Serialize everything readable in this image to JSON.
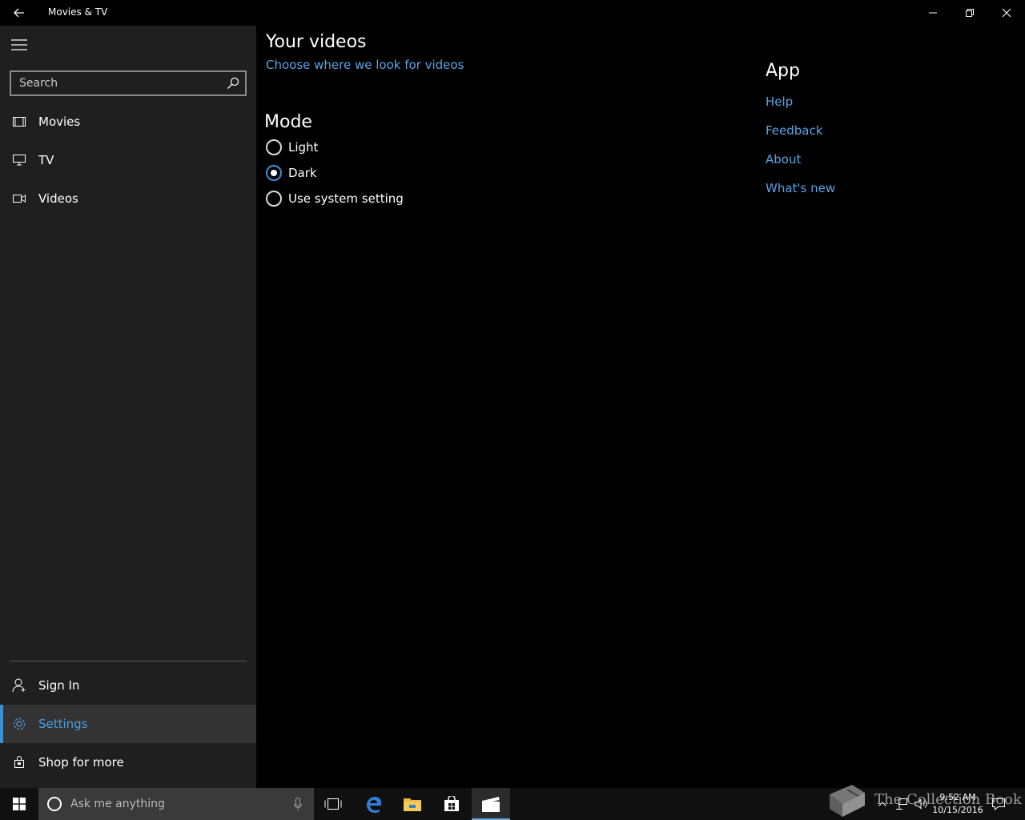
{
  "window": {
    "title": "Movies & TV"
  },
  "sidebar": {
    "search_placeholder": "Search",
    "items": [
      {
        "label": "Movies",
        "icon": "film-icon"
      },
      {
        "label": "TV",
        "icon": "monitor-icon"
      },
      {
        "label": "Videos",
        "icon": "video-camera-icon"
      }
    ],
    "bottom_items": [
      {
        "label": "Sign In",
        "icon": "person-icon"
      },
      {
        "label": "Settings",
        "icon": "gear-icon",
        "selected": true
      },
      {
        "label": "Shop for more",
        "icon": "shopping-bag-icon"
      }
    ]
  },
  "main": {
    "videos_heading": "Your videos",
    "videos_link": "Choose where we look for videos",
    "mode_heading": "Mode",
    "mode_options": [
      {
        "label": "Light",
        "selected": false
      },
      {
        "label": "Dark",
        "selected": true
      },
      {
        "label": "Use system setting",
        "selected": false
      }
    ],
    "app_heading": "App",
    "app_links": [
      "Help",
      "Feedback",
      "About",
      "What's new"
    ]
  },
  "taskbar": {
    "search_placeholder": "Ask me anything",
    "time": "9:52 AM",
    "date": "10/15/2016",
    "watermark": "The Collection Book"
  },
  "colors": {
    "accent": "#3e8fd6",
    "link": "#5aa3e6",
    "sidebar_bg": "#1f1f1f",
    "content_bg": "#000000"
  }
}
